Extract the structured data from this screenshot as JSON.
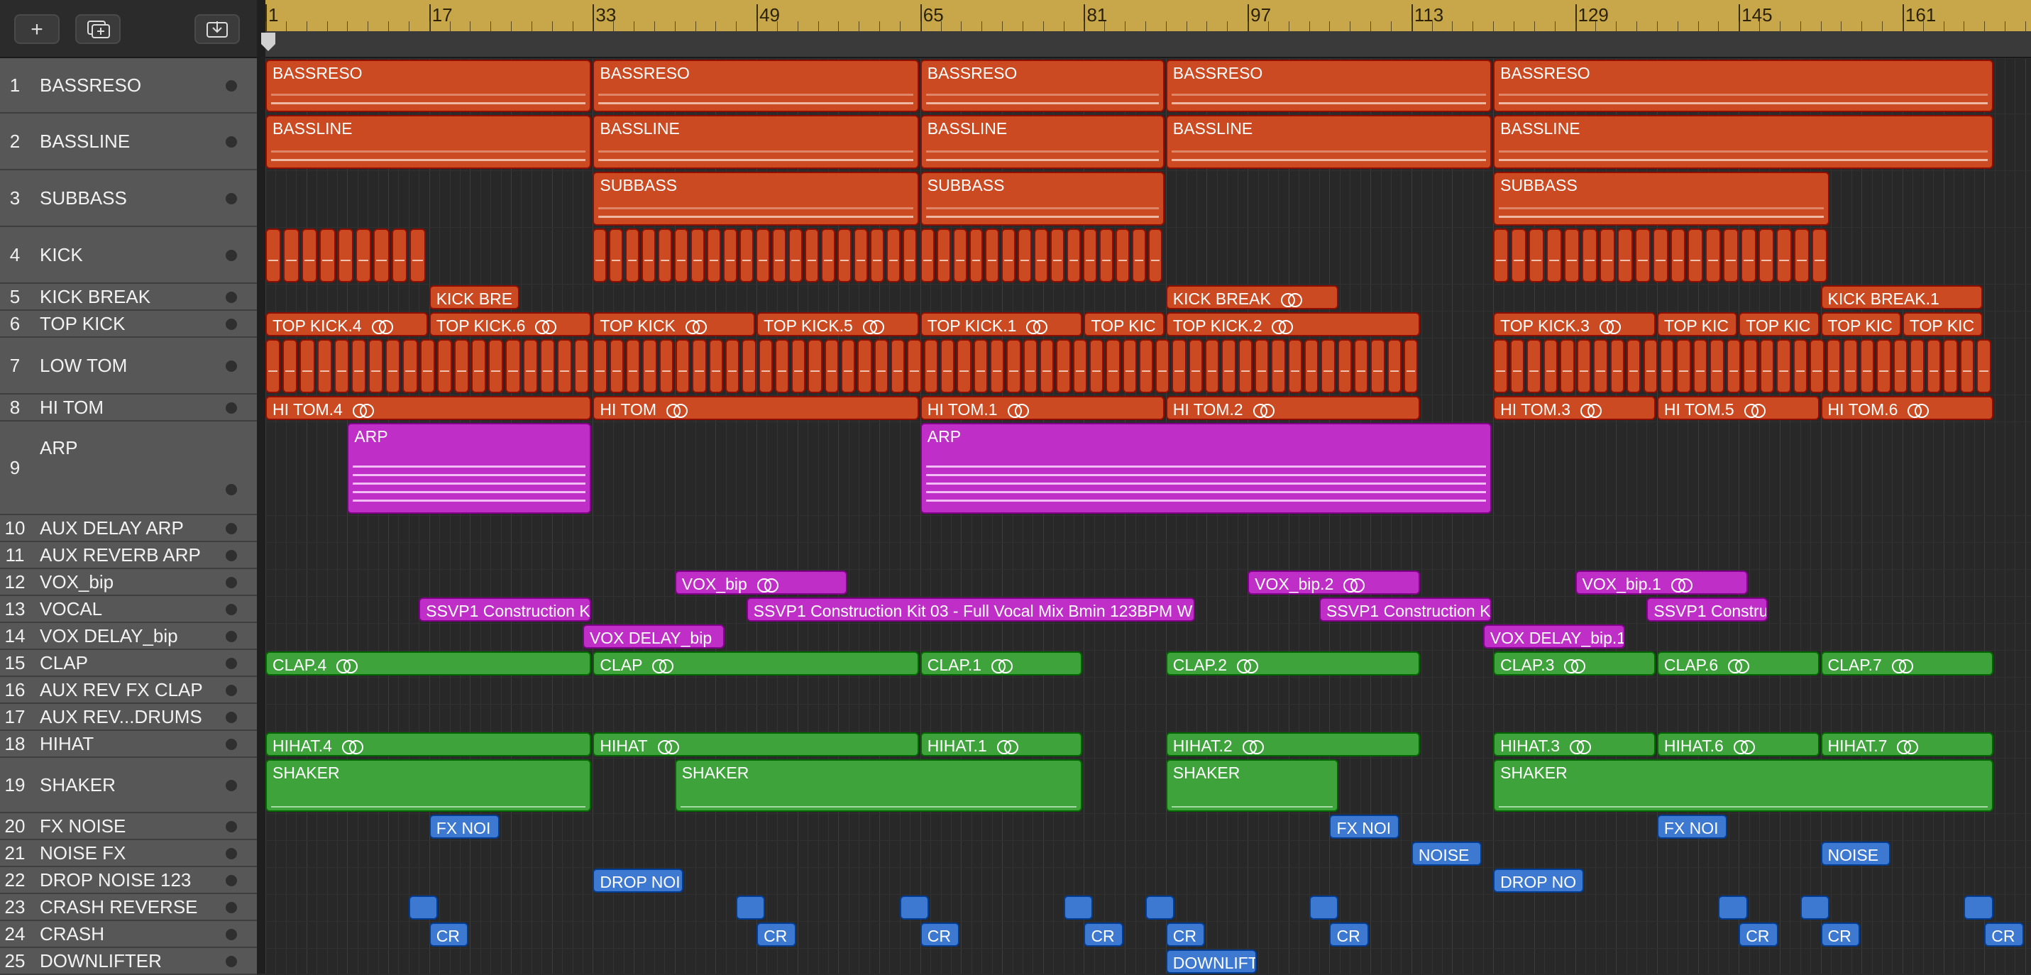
{
  "toolbar": {
    "add_icon": "plus-icon",
    "duplicate_icon": "duplicate-track-icon",
    "download_icon": "download-box-icon"
  },
  "ruler": {
    "marks": [
      "1",
      "17",
      "33",
      "49",
      "65",
      "81",
      "97",
      "113",
      "129",
      "145",
      "161"
    ]
  },
  "tracks": [
    {
      "num": "1",
      "name": "BASSRESO"
    },
    {
      "num": "2",
      "name": "BASSLINE"
    },
    {
      "num": "3",
      "name": "SUBBASS"
    },
    {
      "num": "4",
      "name": "KICK"
    },
    {
      "num": "5",
      "name": "KICK BREAK"
    },
    {
      "num": "6",
      "name": "TOP KICK"
    },
    {
      "num": "7",
      "name": "LOW TOM"
    },
    {
      "num": "8",
      "name": "HI TOM"
    },
    {
      "num": "9",
      "name": "ARP"
    },
    {
      "num": "10",
      "name": "AUX DELAY ARP"
    },
    {
      "num": "11",
      "name": "AUX REVERB ARP"
    },
    {
      "num": "12",
      "name": "VOX_bip"
    },
    {
      "num": "13",
      "name": "VOCAL"
    },
    {
      "num": "14",
      "name": "VOX DELAY_bip"
    },
    {
      "num": "15",
      "name": "CLAP"
    },
    {
      "num": "16",
      "name": "AUX REV FX CLAP"
    },
    {
      "num": "17",
      "name": "AUX REV...DRUMS"
    },
    {
      "num": "18",
      "name": "HIHAT"
    },
    {
      "num": "19",
      "name": "SHAKER"
    },
    {
      "num": "20",
      "name": "FX NOISE"
    },
    {
      "num": "21",
      "name": "NOISE FX"
    },
    {
      "num": "22",
      "name": "DROP NOISE 123"
    },
    {
      "num": "23",
      "name": "CRASH REVERSE"
    },
    {
      "num": "24",
      "name": "CRASH"
    },
    {
      "num": "25",
      "name": "DOWNLIFTER"
    }
  ],
  "colors": {
    "bass": "#cc4a21",
    "arp": "#bf2fc8",
    "drums": "#3fa33c",
    "fx": "#3d78d1",
    "ruler": "#c7a74a"
  },
  "regions": [
    {
      "t": 0,
      "s": 1,
      "e": 32,
      "label": "BASSRESO",
      "c": "bass"
    },
    {
      "t": 0,
      "s": 33,
      "e": 64,
      "label": "BASSRESO",
      "c": "bass"
    },
    {
      "t": 0,
      "s": 65,
      "e": 88,
      "label": "BASSRESO",
      "c": "bass"
    },
    {
      "t": 0,
      "s": 89,
      "e": 120,
      "label": "BASSRESO",
      "c": "bass"
    },
    {
      "t": 0,
      "s": 121,
      "e": 169,
      "label": "BASSRESO",
      "c": "bass"
    },
    {
      "t": 1,
      "s": 1,
      "e": 32,
      "label": "BASSLINE",
      "c": "bass"
    },
    {
      "t": 1,
      "s": 33,
      "e": 64,
      "label": "BASSLINE",
      "c": "bass"
    },
    {
      "t": 1,
      "s": 65,
      "e": 88,
      "label": "BASSLINE",
      "c": "bass"
    },
    {
      "t": 1,
      "s": 89,
      "e": 120,
      "label": "BASSLINE",
      "c": "bass"
    },
    {
      "t": 1,
      "s": 121,
      "e": 169,
      "label": "BASSLINE",
      "c": "bass"
    },
    {
      "t": 2,
      "s": 33,
      "e": 64,
      "label": "SUBBASS",
      "c": "bass"
    },
    {
      "t": 2,
      "s": 65,
      "e": 88,
      "label": "SUBBASS",
      "c": "bass"
    },
    {
      "t": 2,
      "s": 121,
      "e": 153,
      "label": "SUBBASS",
      "c": "bass"
    },
    {
      "t": 4,
      "s": 17,
      "e": 25,
      "label": "KICK BRE",
      "c": "bass"
    },
    {
      "t": 4,
      "s": 89,
      "e": 105,
      "label": "KICK BREAK",
      "c": "bass",
      "loop": true
    },
    {
      "t": 4,
      "s": 153,
      "e": 168,
      "label": "KICK BREAK.1",
      "c": "bass"
    },
    {
      "t": 5,
      "s": 1,
      "e": 16,
      "label": "TOP KICK.4",
      "c": "bass",
      "loop": true
    },
    {
      "t": 5,
      "s": 17,
      "e": 32,
      "label": "TOP KICK.6",
      "c": "bass",
      "loop": true
    },
    {
      "t": 5,
      "s": 33,
      "e": 48,
      "label": "TOP KICK",
      "c": "bass",
      "loop": true
    },
    {
      "t": 5,
      "s": 49,
      "e": 64,
      "label": "TOP KICK.5",
      "c": "bass",
      "loop": true
    },
    {
      "t": 5,
      "s": 65,
      "e": 80,
      "label": "TOP KICK.1",
      "c": "bass",
      "loop": true
    },
    {
      "t": 5,
      "s": 81,
      "e": 88,
      "label": "TOP KIC",
      "c": "bass"
    },
    {
      "t": 5,
      "s": 89,
      "e": 113,
      "label": "TOP KICK.2",
      "c": "bass",
      "loop": true
    },
    {
      "t": 5,
      "s": 121,
      "e": 136,
      "label": "TOP KICK.3",
      "c": "bass",
      "loop": true
    },
    {
      "t": 5,
      "s": 137,
      "e": 144,
      "label": "TOP KIC",
      "c": "bass"
    },
    {
      "t": 5,
      "s": 145,
      "e": 152,
      "label": "TOP KIC",
      "c": "bass"
    },
    {
      "t": 5,
      "s": 153,
      "e": 160,
      "label": "TOP KIC",
      "c": "bass"
    },
    {
      "t": 5,
      "s": 161,
      "e": 168,
      "label": "TOP KIC",
      "c": "bass"
    },
    {
      "t": 7,
      "s": 1,
      "e": 32,
      "label": "HI TOM.4",
      "c": "bass",
      "loop": true
    },
    {
      "t": 7,
      "s": 33,
      "e": 64,
      "label": "HI TOM",
      "c": "bass",
      "loop": true
    },
    {
      "t": 7,
      "s": 65,
      "e": 88,
      "label": "HI TOM.1",
      "c": "bass",
      "loop": true
    },
    {
      "t": 7,
      "s": 89,
      "e": 113,
      "label": "HI TOM.2",
      "c": "bass",
      "loop": true
    },
    {
      "t": 7,
      "s": 121,
      "e": 136,
      "label": "HI TOM.3",
      "c": "bass",
      "loop": true
    },
    {
      "t": 7,
      "s": 137,
      "e": 152,
      "label": "HI TOM.5",
      "c": "bass",
      "loop": true
    },
    {
      "t": 7,
      "s": 153,
      "e": 169,
      "label": "HI TOM.6",
      "c": "bass",
      "loop": true
    },
    {
      "t": 8,
      "s": 9,
      "e": 32,
      "label": "ARP",
      "c": "arp"
    },
    {
      "t": 8,
      "s": 65,
      "e": 120,
      "label": "ARP",
      "c": "arp"
    },
    {
      "t": 11,
      "s": 41,
      "e": 57,
      "label": "VOX_bip",
      "c": "arp",
      "loop": true
    },
    {
      "t": 11,
      "s": 97,
      "e": 113,
      "label": "VOX_bip.2",
      "c": "arp",
      "loop": true
    },
    {
      "t": 11,
      "s": 129,
      "e": 145,
      "label": "VOX_bip.1",
      "c": "arp",
      "loop": true
    },
    {
      "t": 12,
      "s": 16,
      "e": 32,
      "label": "SSVP1 Construction K",
      "c": "arp"
    },
    {
      "t": 12,
      "s": 48,
      "e": 91,
      "label": "SSVP1 Construction Kit 03 - Full Vocal Mix Bmin 123BPM W",
      "c": "arp"
    },
    {
      "t": 12,
      "s": 104,
      "e": 120,
      "label": "SSVP1 Construction K",
      "c": "arp"
    },
    {
      "t": 12,
      "s": 136,
      "e": 147,
      "label": "SSVP1 Constru",
      "c": "arp"
    },
    {
      "t": 13,
      "s": 32,
      "e": 45,
      "label": "VOX DELAY_bip",
      "c": "arp"
    },
    {
      "t": 13,
      "s": 120,
      "e": 133,
      "label": "VOX DELAY_bip.1",
      "c": "arp"
    },
    {
      "t": 14,
      "s": 1,
      "e": 32,
      "label": "CLAP.4",
      "c": "drums",
      "loop": true
    },
    {
      "t": 14,
      "s": 33,
      "e": 64,
      "label": "CLAP",
      "c": "drums",
      "loop": true
    },
    {
      "t": 14,
      "s": 65,
      "e": 80,
      "label": "CLAP.1",
      "c": "drums",
      "loop": true
    },
    {
      "t": 14,
      "s": 89,
      "e": 113,
      "label": "CLAP.2",
      "c": "drums",
      "loop": true
    },
    {
      "t": 14,
      "s": 121,
      "e": 136,
      "label": "CLAP.3",
      "c": "drums",
      "loop": true
    },
    {
      "t": 14,
      "s": 137,
      "e": 152,
      "label": "CLAP.6",
      "c": "drums",
      "loop": true
    },
    {
      "t": 14,
      "s": 153,
      "e": 169,
      "label": "CLAP.7",
      "c": "drums",
      "loop": true
    },
    {
      "t": 17,
      "s": 1,
      "e": 32,
      "label": "HIHAT.4",
      "c": "drums",
      "loop": true
    },
    {
      "t": 17,
      "s": 33,
      "e": 64,
      "label": "HIHAT",
      "c": "drums",
      "loop": true
    },
    {
      "t": 17,
      "s": 65,
      "e": 80,
      "label": "HIHAT.1",
      "c": "drums",
      "loop": true
    },
    {
      "t": 17,
      "s": 89,
      "e": 113,
      "label": "HIHAT.2",
      "c": "drums",
      "loop": true
    },
    {
      "t": 17,
      "s": 121,
      "e": 136,
      "label": "HIHAT.3",
      "c": "drums",
      "loop": true
    },
    {
      "t": 17,
      "s": 137,
      "e": 152,
      "label": "HIHAT.6",
      "c": "drums",
      "loop": true
    },
    {
      "t": 17,
      "s": 153,
      "e": 169,
      "label": "HIHAT.7",
      "c": "drums",
      "loop": true
    },
    {
      "t": 18,
      "s": 1,
      "e": 32,
      "label": "SHAKER",
      "c": "drums"
    },
    {
      "t": 18,
      "s": 41,
      "e": 80,
      "label": "SHAKER",
      "c": "drums"
    },
    {
      "t": 18,
      "s": 89,
      "e": 105,
      "label": "SHAKER",
      "c": "drums"
    },
    {
      "t": 18,
      "s": 121,
      "e": 169,
      "label": "SHAKER",
      "c": "drums"
    },
    {
      "t": 19,
      "s": 17,
      "e": 23,
      "label": "FX NOI",
      "c": "fx"
    },
    {
      "t": 19,
      "s": 105,
      "e": 111,
      "label": "FX NOI",
      "c": "fx"
    },
    {
      "t": 19,
      "s": 137,
      "e": 143,
      "label": "FX NOI",
      "c": "fx"
    },
    {
      "t": 20,
      "s": 113,
      "e": 119,
      "label": "NOISE",
      "c": "fx"
    },
    {
      "t": 20,
      "s": 153,
      "e": 159,
      "label": "NOISE",
      "c": "fx"
    },
    {
      "t": 21,
      "s": 33,
      "e": 41,
      "label": "DROP NOI",
      "c": "fx"
    },
    {
      "t": 21,
      "s": 121,
      "e": 129,
      "label": "DROP NO",
      "c": "fx"
    },
    {
      "t": 22,
      "s": 15,
      "e": 17,
      "label": "",
      "c": "fx"
    },
    {
      "t": 22,
      "s": 47,
      "e": 49,
      "label": "",
      "c": "fx"
    },
    {
      "t": 22,
      "s": 63,
      "e": 65,
      "label": "",
      "c": "fx"
    },
    {
      "t": 22,
      "s": 79,
      "e": 81,
      "label": "",
      "c": "fx"
    },
    {
      "t": 22,
      "s": 87,
      "e": 89,
      "label": "",
      "c": "fx"
    },
    {
      "t": 22,
      "s": 103,
      "e": 105,
      "label": "",
      "c": "fx"
    },
    {
      "t": 22,
      "s": 143,
      "e": 145,
      "label": "",
      "c": "fx"
    },
    {
      "t": 22,
      "s": 151,
      "e": 153,
      "label": "",
      "c": "fx"
    },
    {
      "t": 22,
      "s": 167,
      "e": 169,
      "label": "",
      "c": "fx"
    },
    {
      "t": 23,
      "s": 17,
      "e": 20,
      "label": "CR",
      "c": "fx"
    },
    {
      "t": 23,
      "s": 49,
      "e": 52,
      "label": "CR",
      "c": "fx"
    },
    {
      "t": 23,
      "s": 65,
      "e": 68,
      "label": "CR",
      "c": "fx"
    },
    {
      "t": 23,
      "s": 81,
      "e": 84,
      "label": "CR",
      "c": "fx"
    },
    {
      "t": 23,
      "s": 89,
      "e": 92,
      "label": "CR",
      "c": "fx"
    },
    {
      "t": 23,
      "s": 105,
      "e": 108,
      "label": "CR",
      "c": "fx"
    },
    {
      "t": 23,
      "s": 145,
      "e": 148,
      "label": "CR",
      "c": "fx"
    },
    {
      "t": 23,
      "s": 153,
      "e": 156,
      "label": "CR",
      "c": "fx"
    },
    {
      "t": 23,
      "s": 169,
      "e": 172,
      "label": "CR",
      "c": "fx"
    },
    {
      "t": 24,
      "s": 89,
      "e": 97,
      "label": "DOWNLIFT",
      "c": "fx"
    }
  ],
  "segmented": [
    {
      "t": 3,
      "s": 1,
      "e": 16,
      "n": 9,
      "c": "bass"
    },
    {
      "t": 3,
      "s": 33,
      "e": 64,
      "n": 20,
      "c": "bass"
    },
    {
      "t": 3,
      "s": 65,
      "e": 88,
      "n": 15,
      "c": "bass"
    },
    {
      "t": 3,
      "s": 121,
      "e": 153,
      "n": 19,
      "c": "bass"
    },
    {
      "t": 6,
      "s": 1,
      "e": 32,
      "n": 19,
      "c": "bass"
    },
    {
      "t": 6,
      "s": 33,
      "e": 113,
      "n": 50,
      "c": "bass"
    },
    {
      "t": 6,
      "s": 121,
      "e": 169,
      "n": 30,
      "c": "bass"
    }
  ]
}
